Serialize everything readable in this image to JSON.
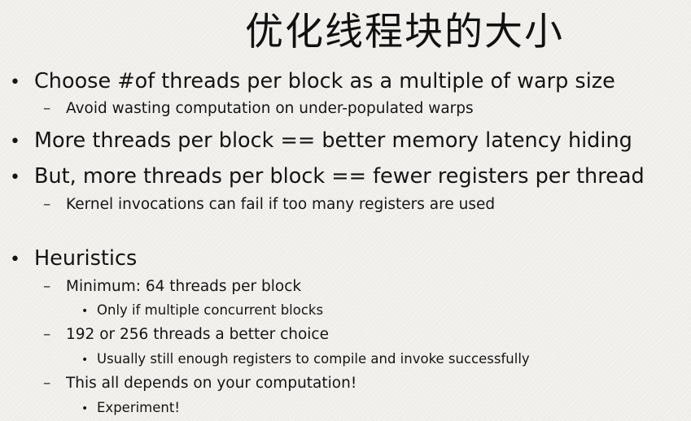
{
  "title": "优化线程块的大小",
  "bullets": {
    "b1": "Choose #of threads per block as a multiple of warp  size",
    "b1_sub1": "Avoid wasting computation on under-populated warps",
    "b2": "More threads per block == better memory latency hiding",
    "b3": "But, more threads per block == fewer registers per  thread",
    "b3_sub1": "Kernel invocations can fail if too many registers are used",
    "b4": "Heuristics",
    "b4_sub1": "Minimum: 64 threads per block",
    "b4_sub1_sub1": "Only if multiple concurrent blocks",
    "b4_sub2": "192 or 256 threads a better choice",
    "b4_sub2_sub1": "Usually still enough registers to compile and invoke successfully",
    "b4_sub3": "This all depends on your computation!",
    "b4_sub3_sub1": "Experiment!"
  },
  "markers": {
    "bullet": "•",
    "dash": "–",
    "dot": "•"
  }
}
